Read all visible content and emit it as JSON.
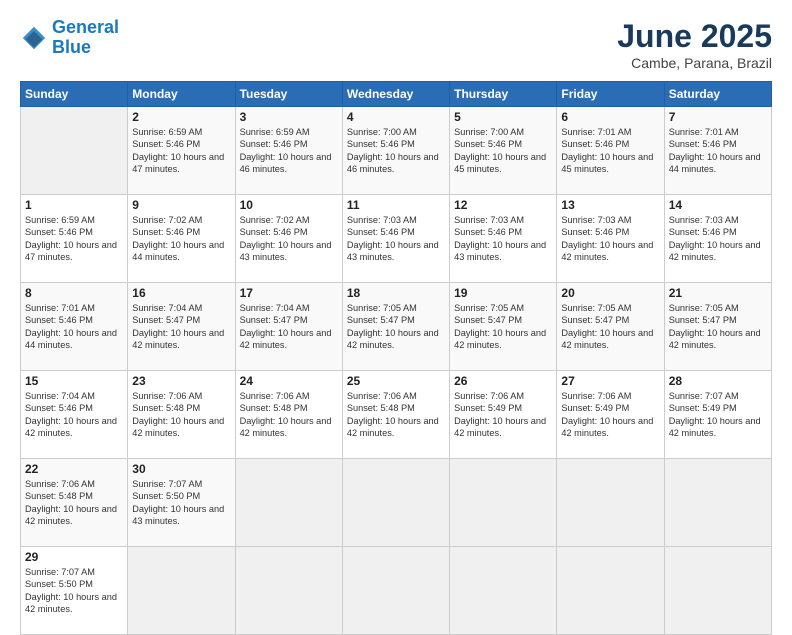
{
  "app": {
    "logo_line1": "General",
    "logo_line2": "Blue"
  },
  "header": {
    "title": "June 2025",
    "subtitle": "Cambe, Parana, Brazil"
  },
  "calendar": {
    "days_of_week": [
      "Sunday",
      "Monday",
      "Tuesday",
      "Wednesday",
      "Thursday",
      "Friday",
      "Saturday"
    ],
    "weeks": [
      [
        {
          "day": "",
          "text": ""
        },
        {
          "day": "2",
          "text": "Sunrise: 6:59 AM\nSunset: 5:46 PM\nDaylight: 10 hours\nand 47 minutes."
        },
        {
          "day": "3",
          "text": "Sunrise: 6:59 AM\nSunset: 5:46 PM\nDaylight: 10 hours\nand 46 minutes."
        },
        {
          "day": "4",
          "text": "Sunrise: 7:00 AM\nSunset: 5:46 PM\nDaylight: 10 hours\nand 46 minutes."
        },
        {
          "day": "5",
          "text": "Sunrise: 7:00 AM\nSunset: 5:46 PM\nDaylight: 10 hours\nand 45 minutes."
        },
        {
          "day": "6",
          "text": "Sunrise: 7:01 AM\nSunset: 5:46 PM\nDaylight: 10 hours\nand 45 minutes."
        },
        {
          "day": "7",
          "text": "Sunrise: 7:01 AM\nSunset: 5:46 PM\nDaylight: 10 hours\nand 44 minutes."
        }
      ],
      [
        {
          "day": "1",
          "text": "Sunrise: 6:59 AM\nSunset: 5:46 PM\nDaylight: 10 hours\nand 47 minutes."
        },
        {
          "day": "9",
          "text": "Sunrise: 7:02 AM\nSunset: 5:46 PM\nDaylight: 10 hours\nand 44 minutes."
        },
        {
          "day": "10",
          "text": "Sunrise: 7:02 AM\nSunset: 5:46 PM\nDaylight: 10 hours\nand 43 minutes."
        },
        {
          "day": "11",
          "text": "Sunrise: 7:03 AM\nSunset: 5:46 PM\nDaylight: 10 hours\nand 43 minutes."
        },
        {
          "day": "12",
          "text": "Sunrise: 7:03 AM\nSunset: 5:46 PM\nDaylight: 10 hours\nand 43 minutes."
        },
        {
          "day": "13",
          "text": "Sunrise: 7:03 AM\nSunset: 5:46 PM\nDaylight: 10 hours\nand 42 minutes."
        },
        {
          "day": "14",
          "text": "Sunrise: 7:03 AM\nSunset: 5:46 PM\nDaylight: 10 hours\nand 42 minutes."
        }
      ],
      [
        {
          "day": "8",
          "text": "Sunrise: 7:01 AM\nSunset: 5:46 PM\nDaylight: 10 hours\nand 44 minutes."
        },
        {
          "day": "16",
          "text": "Sunrise: 7:04 AM\nSunset: 5:47 PM\nDaylight: 10 hours\nand 42 minutes."
        },
        {
          "day": "17",
          "text": "Sunrise: 7:04 AM\nSunset: 5:47 PM\nDaylight: 10 hours\nand 42 minutes."
        },
        {
          "day": "18",
          "text": "Sunrise: 7:05 AM\nSunset: 5:47 PM\nDaylight: 10 hours\nand 42 minutes."
        },
        {
          "day": "19",
          "text": "Sunrise: 7:05 AM\nSunset: 5:47 PM\nDaylight: 10 hours\nand 42 minutes."
        },
        {
          "day": "20",
          "text": "Sunrise: 7:05 AM\nSunset: 5:47 PM\nDaylight: 10 hours\nand 42 minutes."
        },
        {
          "day": "21",
          "text": "Sunrise: 7:05 AM\nSunset: 5:47 PM\nDaylight: 10 hours\nand 42 minutes."
        }
      ],
      [
        {
          "day": "15",
          "text": "Sunrise: 7:04 AM\nSunset: 5:46 PM\nDaylight: 10 hours\nand 42 minutes."
        },
        {
          "day": "23",
          "text": "Sunrise: 7:06 AM\nSunset: 5:48 PM\nDaylight: 10 hours\nand 42 minutes."
        },
        {
          "day": "24",
          "text": "Sunrise: 7:06 AM\nSunset: 5:48 PM\nDaylight: 10 hours\nand 42 minutes."
        },
        {
          "day": "25",
          "text": "Sunrise: 7:06 AM\nSunset: 5:48 PM\nDaylight: 10 hours\nand 42 minutes."
        },
        {
          "day": "26",
          "text": "Sunrise: 7:06 AM\nSunset: 5:49 PM\nDaylight: 10 hours\nand 42 minutes."
        },
        {
          "day": "27",
          "text": "Sunrise: 7:06 AM\nSunset: 5:49 PM\nDaylight: 10 hours\nand 42 minutes."
        },
        {
          "day": "28",
          "text": "Sunrise: 7:07 AM\nSunset: 5:49 PM\nDaylight: 10 hours\nand 42 minutes."
        }
      ],
      [
        {
          "day": "22",
          "text": "Sunrise: 7:06 AM\nSunset: 5:48 PM\nDaylight: 10 hours\nand 42 minutes."
        },
        {
          "day": "30",
          "text": "Sunrise: 7:07 AM\nSunset: 5:50 PM\nDaylight: 10 hours\nand 43 minutes."
        },
        {
          "day": "",
          "text": ""
        },
        {
          "day": "",
          "text": ""
        },
        {
          "day": "",
          "text": ""
        },
        {
          "day": "",
          "text": ""
        },
        {
          "day": "",
          "text": ""
        }
      ],
      [
        {
          "day": "29",
          "text": "Sunrise: 7:07 AM\nSunset: 5:50 PM\nDaylight: 10 hours\nand 42 minutes."
        },
        {
          "day": "",
          "text": ""
        },
        {
          "day": "",
          "text": ""
        },
        {
          "day": "",
          "text": ""
        },
        {
          "day": "",
          "text": ""
        },
        {
          "day": "",
          "text": ""
        },
        {
          "day": "",
          "text": ""
        }
      ]
    ]
  }
}
